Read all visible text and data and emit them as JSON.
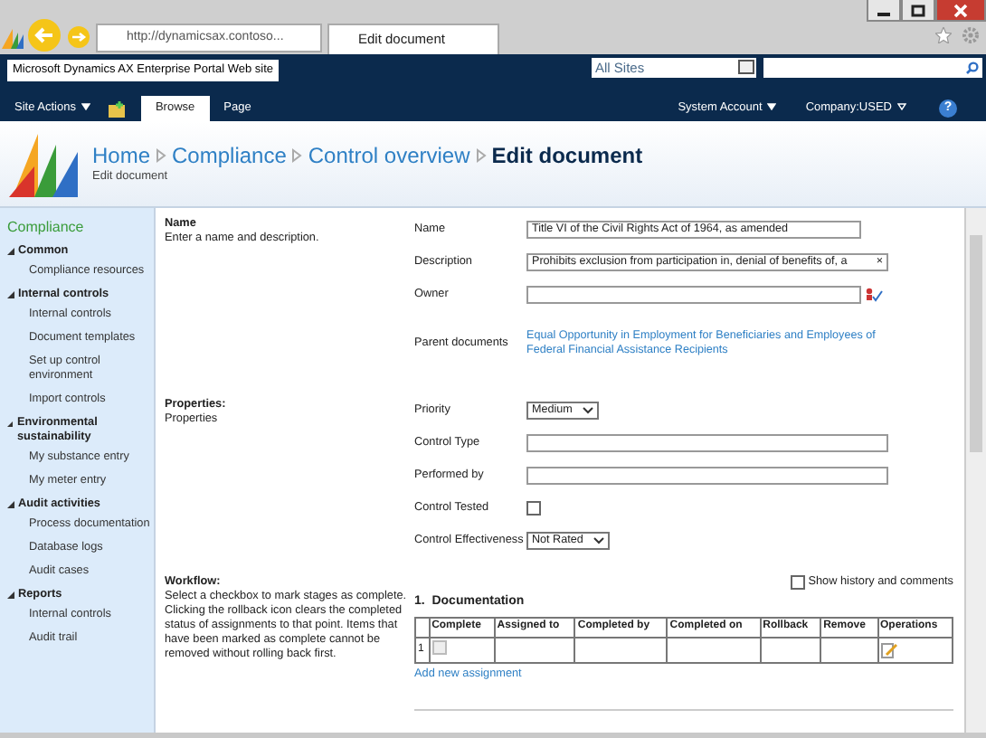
{
  "browser": {
    "address": "http://dynamicsax.contoso...",
    "tab_title": "Edit document"
  },
  "topbar": {
    "site_title": "Microsoft Dynamics AX Enterprise Portal Web site",
    "scope": "All Sites"
  },
  "ribbon": {
    "site_actions": "Site Actions",
    "tabs": [
      {
        "label": "Browse",
        "selected": true
      },
      {
        "label": "Page",
        "selected": false
      }
    ],
    "account": "System Account",
    "company": "Company:USED",
    "help": "?"
  },
  "breadcrumb": [
    "Home",
    "Compliance",
    "Control overview",
    "Edit document"
  ],
  "subtitle": "Edit document",
  "sidebar": {
    "heading": "Compliance",
    "groups": [
      {
        "label": "Common",
        "expanded": true,
        "children": [
          "Compliance resources"
        ]
      },
      {
        "label": "Internal controls",
        "expanded": true,
        "children": [
          "Internal controls",
          "Document templates",
          "Set up control environment",
          "Import controls"
        ]
      },
      {
        "label": "Environmental sustainability",
        "expanded": true,
        "children": [
          "My substance entry",
          "My meter entry"
        ]
      },
      {
        "label": "Audit activities",
        "expanded": true,
        "children": [
          "Process documentation",
          "Database logs",
          "Audit cases"
        ]
      },
      {
        "label": "Reports",
        "expanded": true,
        "children": [
          "Internal controls",
          "Audit trail"
        ]
      }
    ]
  },
  "sections": [
    {
      "title": "Name",
      "description": "Enter a name and description.",
      "fields": [
        {
          "kind": "text",
          "label": "Name",
          "value": "Title VI of the Civil Rights Act of 1964, as amended"
        },
        {
          "kind": "text",
          "label": "Description",
          "value": "Prohibits exclusion from participation in, denial of benefits of, a",
          "clear": "×"
        },
        {
          "kind": "people",
          "label": "Owner"
        },
        {
          "kind": "link",
          "label": "Parent documents",
          "value": "Equal Opportunity in Employment for Beneficiaries and Employees of Federal Financial Assistance Recipients"
        }
      ]
    },
    {
      "title": "Properties:",
      "description": "Properties",
      "fields": [
        {
          "kind": "select",
          "label": "Priority",
          "value": "Medium"
        },
        {
          "kind": "text",
          "label": "Control Type"
        },
        {
          "kind": "text",
          "label": "Performed by"
        },
        {
          "kind": "checkbox",
          "label": "Control Tested",
          "checked": false
        },
        {
          "kind": "select",
          "label": "Control Effectiveness",
          "value": "Not Rated"
        }
      ]
    }
  ],
  "workflow": {
    "title": "Workflow:",
    "description": "Select a checkbox to mark stages as complete. Clicking the rollback icon clears the completed status of assignments to that point. Items that have been marked as complete cannot be removed without rolling back first.",
    "show_history": {
      "label": "Show history and comments",
      "checked": false
    },
    "stage_title": "1.  Documentation",
    "columns": [
      "",
      "Complete",
      "Assigned to",
      "Completed by",
      "Completed on",
      "Rollback",
      "Remove",
      "Operations"
    ],
    "rows": [
      {
        "number": "1",
        "complete": false
      }
    ],
    "add_link": "Add new assignment"
  }
}
